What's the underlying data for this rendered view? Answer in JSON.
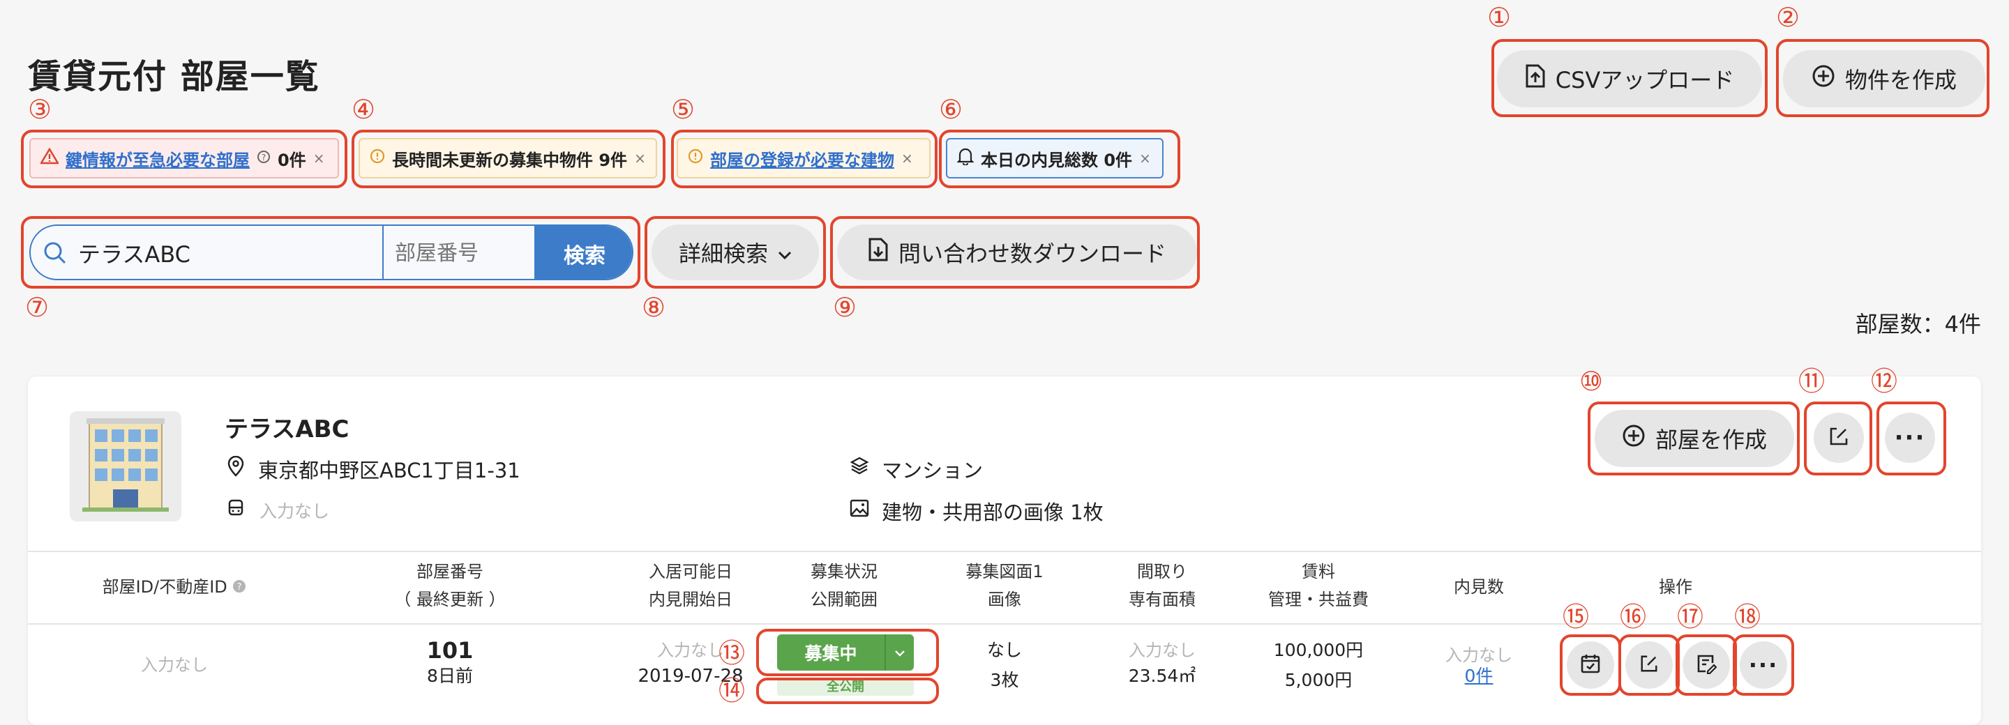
{
  "header": {
    "title": "賃貸元付 部屋一覧",
    "csv_upload_label": "CSVアップロード",
    "create_property_label": "物件を作成"
  },
  "alerts": [
    {
      "link": "鍵情報が至急必要な部屋",
      "count": "0件"
    },
    {
      "text": "長時間未更新の募集中物件 9件"
    },
    {
      "link": "部屋の登録が必要な建物"
    },
    {
      "text": "本日の内見総数 0件"
    }
  ],
  "search": {
    "keyword_value": "テラスABC",
    "room_placeholder": "部屋番号",
    "search_label": "検索",
    "advanced_label": "詳細検索",
    "download_label": "問い合わせ数ダウンロード"
  },
  "room_count": "部屋数：4件",
  "building": {
    "name": "テラスABC",
    "address": "東京都中野区ABC1丁目1-31",
    "type": "マンション",
    "station_empty": "入力なし",
    "images": "建物・共用部の画像 1枚",
    "create_room_label": "部屋を作成"
  },
  "table": {
    "headers": [
      {
        "l1": "部屋ID/不動産ID"
      },
      {
        "l1": "部屋番号",
        "l2": "（ 最終更新 ）"
      },
      {
        "l1": "入居可能日",
        "l2": "内見開始日"
      },
      {
        "l1": "募集状況",
        "l2": "公開範囲"
      },
      {
        "l1": "募集図面1",
        "l2": "画像"
      },
      {
        "l1": "間取り",
        "l2": "専有面積"
      },
      {
        "l1": "賃料",
        "l2": "管理・共益費"
      },
      {
        "l1": "内見数"
      },
      {
        "l1": "操作"
      }
    ],
    "row": {
      "room_id": "入力なし",
      "room_no": "101",
      "updated": "8日前",
      "move_in": "入力なし",
      "viewing_start": "2019-07-28",
      "status": "募集中",
      "scope": "全公開",
      "floorplan": "なし",
      "images": "3枚",
      "layout": "入力なし",
      "area": "23.54㎡",
      "rent": "100,000円",
      "fee": "5,000円",
      "viewings_empty": "入力なし",
      "viewings": "0件"
    }
  },
  "callout_numbers": [
    "①",
    "②",
    "③",
    "④",
    "⑤",
    "⑥",
    "⑦",
    "⑧",
    "⑨",
    "⑩",
    "⑪",
    "⑫",
    "⑬",
    "⑭",
    "⑮",
    "⑯",
    "⑰",
    "⑱"
  ],
  "colors": {
    "accent": "#3d7cc9",
    "callout": "#e2452d",
    "status_green": "#5aa54b",
    "link": "#2f6fcc"
  }
}
